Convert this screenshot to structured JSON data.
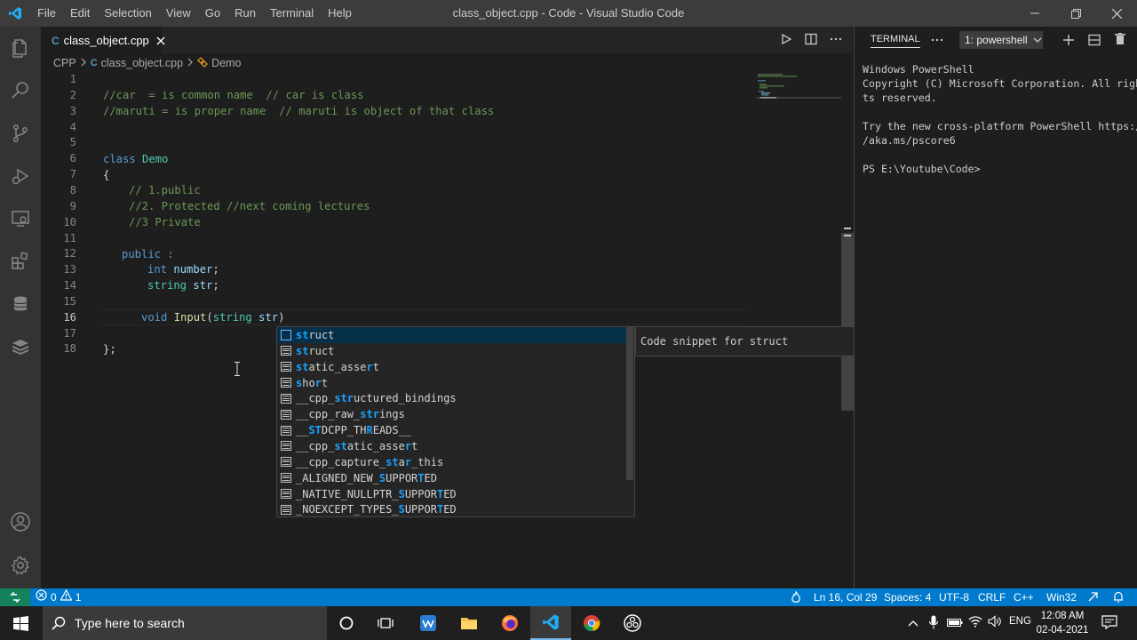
{
  "app": {
    "window_title": "class_object.cpp - Code - Visual Studio Code",
    "menu": [
      "File",
      "Edit",
      "Selection",
      "View",
      "Go",
      "Run",
      "Terminal",
      "Help"
    ]
  },
  "tab": {
    "icon_text": "C",
    "label": "class_object.cpp"
  },
  "breadcrumb": {
    "folder": "CPP",
    "file": "class_object.cpp",
    "symbol": "Demo"
  },
  "editor": {
    "current_line": 16,
    "line_numbers": [
      "1",
      "2",
      "3",
      "4",
      "5",
      "6",
      "7",
      "8",
      "9",
      "10",
      "11",
      "12",
      "13",
      "14",
      "15",
      "16",
      "17",
      "18"
    ],
    "lines": {
      "l2": "//car  = is common name  // car is class",
      "l3": "//maruti = is proper name  // maruti is object of that class",
      "l6_kw": "class",
      "l6_name": "Demo",
      "l7": "{",
      "l8": "// 1.public",
      "l9": "//2. Protected //next coming lectures",
      "l10": "//3 Private",
      "l12_kw": "public",
      "l12_rest": " :",
      "l13_type": "int",
      "l13_var": "number",
      "l13_end": ";",
      "l14_type": "string",
      "l14_var": "str",
      "l14_end": ";",
      "l16_kw": "void",
      "l16_fn": "Input",
      "l16_paren": "(",
      "l16_type": "string",
      "l16_var": "str",
      "l16_close": ")",
      "l18": "};"
    }
  },
  "suggest": {
    "items": [
      {
        "pre": "",
        "hl": "st",
        "mid": "ruct",
        "hl2": "",
        "post": "",
        "kind": "snippet"
      },
      {
        "pre": "",
        "hl": "st",
        "mid": "ruct",
        "hl2": "",
        "post": "",
        "kind": "keyword"
      },
      {
        "pre": "",
        "hl": "st",
        "mid": "atic_asse",
        "hl2": "r",
        "post": "t",
        "kind": "keyword"
      },
      {
        "pre": "",
        "hl": "s",
        "mid": "ho",
        "hl2": "r",
        "post": "t",
        "kind": "keyword"
      },
      {
        "pre": "__cpp_",
        "hl": "str",
        "mid": "uctured_bindings",
        "hl2": "",
        "post": "",
        "kind": "keyword"
      },
      {
        "pre": "__cpp_raw_",
        "hl": "str",
        "mid": "ings",
        "hl2": "",
        "post": "",
        "kind": "keyword"
      },
      {
        "pre": "__",
        "hl": "ST",
        "mid": "DCPP_TH",
        "hl2": "R",
        "post": "EADS__",
        "kind": "keyword"
      },
      {
        "pre": "__cpp_",
        "hl": "st",
        "mid": "atic_asse",
        "hl2": "r",
        "post": "t",
        "kind": "keyword"
      },
      {
        "pre": "__cpp_capture_",
        "hl": "st",
        "mid": "a",
        "hl2": "r",
        "post": "_this",
        "kind": "keyword"
      },
      {
        "pre": "_ALIGNED_NEW_",
        "hl": "S",
        "mid": "UPPOR",
        "hl2": "T",
        "post": "ED",
        "kind": "keyword"
      },
      {
        "pre": "_NATIVE_NULLPTR_",
        "hl": "S",
        "mid": "UPPOR",
        "hl2": "T",
        "post": "ED",
        "kind": "keyword"
      },
      {
        "pre": "_NOEXCEPT_TYPES_",
        "hl": "S",
        "mid": "UPPOR",
        "hl2": "T",
        "post": "ED",
        "kind": "keyword"
      }
    ],
    "detail": "Code snippet for struct"
  },
  "terminal": {
    "tab_label": "TERMINAL",
    "selector": "1: powershell",
    "output": "Windows PowerShell\nCopyright (C) Microsoft Corporation. All righ\nts reserved.\n\nTry the new cross-platform PowerShell https:/\n/aka.ms/pscore6\n\nPS E:\\Youtube\\Code>"
  },
  "status": {
    "errors": "0",
    "warnings": "1",
    "position": "Ln 16, Col 29",
    "spaces": "Spaces: 4",
    "encoding": "UTF-8",
    "eol": "CRLF",
    "language": "C++",
    "platform": "Win32"
  },
  "taskbar": {
    "search_placeholder": "Type here to search",
    "language": "ENG",
    "time": "12:08 AM",
    "date": "02-04-2021"
  },
  "colors": {
    "accent": "#007acc",
    "remote": "#16825d",
    "keyword": "#569cd6",
    "comment": "#6a9955",
    "type": "#4ec9b0",
    "function": "#dcdcaa",
    "variable": "#9cdcfe"
  }
}
